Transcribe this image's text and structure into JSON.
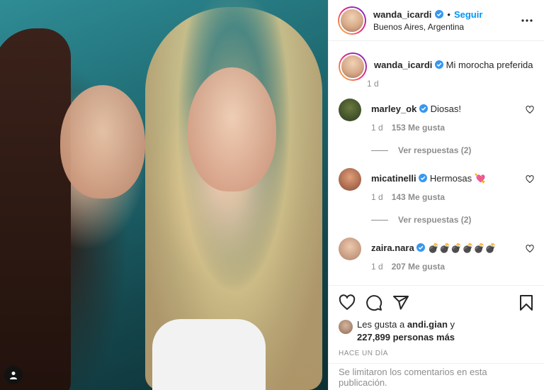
{
  "header": {
    "username": "wanda_icardi",
    "separator": "•",
    "follow_label": "Seguir",
    "location": "Buenos Aires, Argentina"
  },
  "caption": {
    "username": "wanda_icardi",
    "text": "Mi morocha preferida",
    "time": "1 d"
  },
  "comments": [
    {
      "username": "marley_ok",
      "text": "Diosas!",
      "time": "1 d",
      "likes": "153 Me gusta",
      "replies": "Ver respuestas (2)"
    },
    {
      "username": "micatinelli",
      "text": "Hermosas 💘",
      "time": "1 d",
      "likes": "143 Me gusta",
      "replies": "Ver respuestas (2)"
    },
    {
      "username": "zaira.nara",
      "text": "💣💣💣💣💣💣",
      "time": "1 d",
      "likes": "207 Me gusta"
    }
  ],
  "likes": {
    "prefix": "Les gusta a ",
    "user": "andi.gian",
    "connector": " y",
    "count": "227,899 personas más"
  },
  "posted_ago": "HACE UN DÍA",
  "footer": {
    "comments_limited": "Se limitaron los comentarios en esta publicación."
  },
  "colors": {
    "accent": "#0095f6",
    "muted": "#8e8e8e",
    "text": "#262626"
  },
  "icons": [
    "user-tag-icon",
    "verified-badge-icon",
    "more-options-icon",
    "heart-icon",
    "comment-icon",
    "share-icon",
    "bookmark-icon"
  ]
}
